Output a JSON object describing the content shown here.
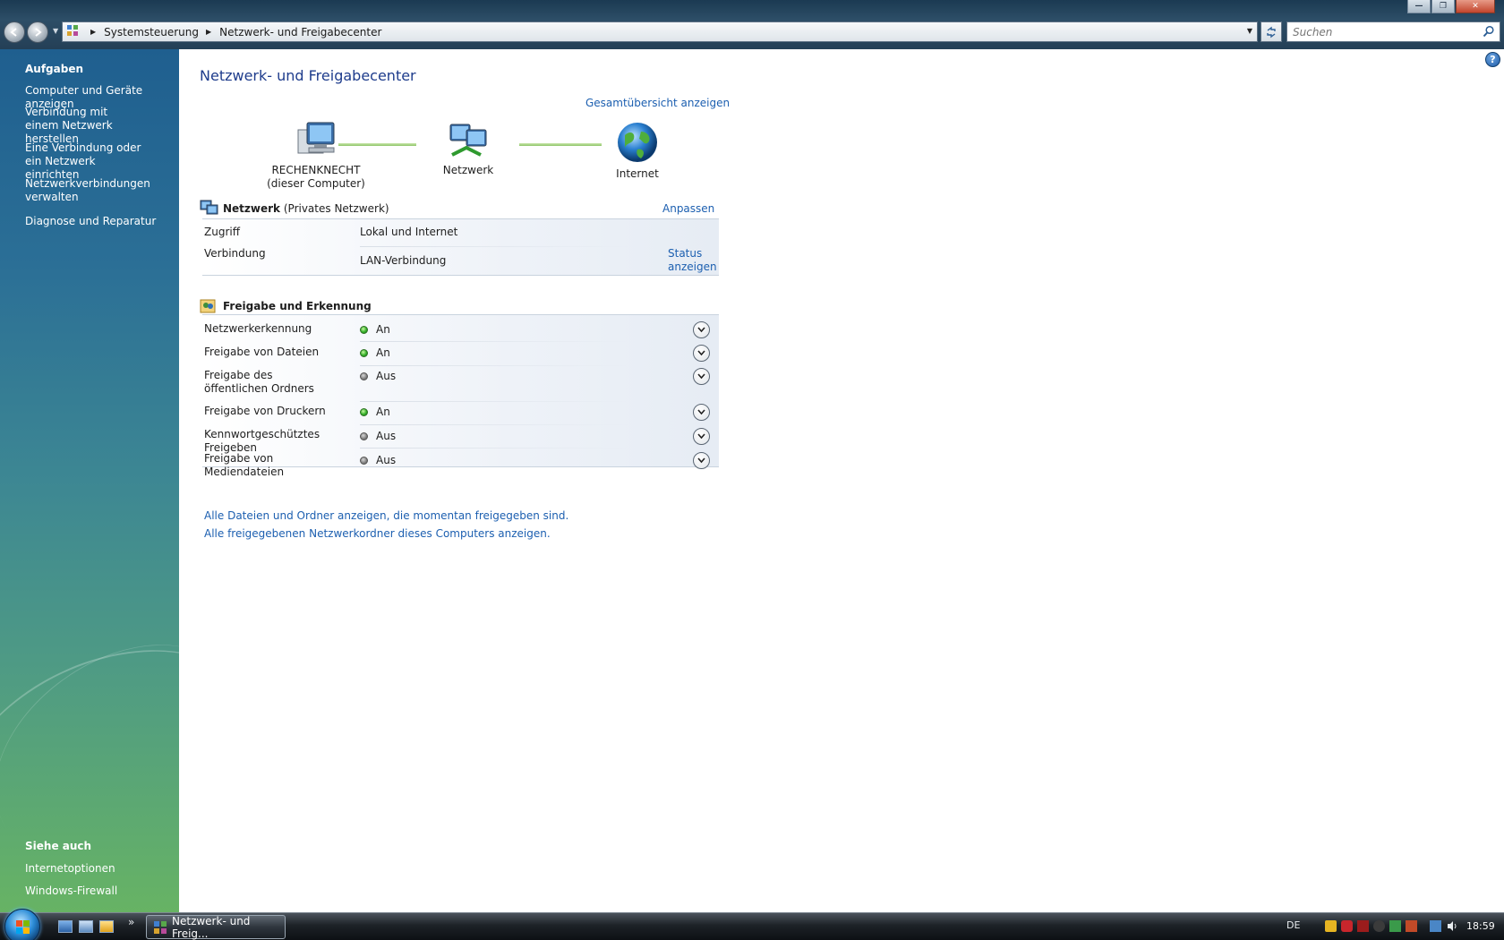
{
  "window": {
    "controls": {
      "minimize": "—",
      "maximize": "❐",
      "close": "✕"
    }
  },
  "navigation": {
    "back_icon": "back-arrow",
    "forward_icon": "forward-arrow"
  },
  "address": {
    "crumbs": [
      "Systemsteuerung",
      "Netzwerk- und Freigabecenter"
    ]
  },
  "search": {
    "placeholder": "Suchen"
  },
  "sidebar": {
    "tasks_heading": "Aufgaben",
    "tasks": [
      "Computer und Geräte anzeigen",
      "Verbindung mit einem Netzwerk herstellen",
      "Eine Verbindung oder ein Netzwerk einrichten",
      "Netzwerkverbindungen verwalten",
      "Diagnose und Reparatur"
    ],
    "see_also_heading": "Siehe auch",
    "see_also": [
      "Internetoptionen",
      "Windows-Firewall"
    ]
  },
  "main": {
    "title": "Netzwerk- und Freigabecenter",
    "overview_link": "Gesamtübersicht anzeigen",
    "map": {
      "computer_name": "RECHENKNECHT",
      "computer_sub": "(dieser Computer)",
      "network_label": "Netzwerk",
      "internet_label": "Internet"
    },
    "network": {
      "name": "Netzwerk",
      "type": "(Privates Netzwerk)",
      "customize_link": "Anpassen",
      "access_label": "Zugriff",
      "access_value": "Lokal und Internet",
      "connection_label": "Verbindung",
      "connection_value": "LAN-Verbindung",
      "status_link_1": "Status",
      "status_link_2": "anzeigen"
    },
    "sharing": {
      "heading": "Freigabe und Erkennung",
      "items": [
        {
          "label": "Netzwerkerkennung",
          "state": "An",
          "on": true
        },
        {
          "label": "Freigabe von Dateien",
          "state": "An",
          "on": true
        },
        {
          "label": "Freigabe des öffentlichen Ordners",
          "state": "Aus",
          "on": false
        },
        {
          "label": "Freigabe von Druckern",
          "state": "An",
          "on": true
        },
        {
          "label": "Kennwortgeschütztes Freigeben",
          "state": "Aus",
          "on": false
        },
        {
          "label": "Freigabe von Mediendateien",
          "state": "Aus",
          "on": false
        }
      ]
    },
    "links": [
      "Alle Dateien und Ordner anzeigen, die momentan freigegeben sind.",
      "Alle freigegebenen Netzwerkordner dieses Computers anzeigen."
    ]
  },
  "taskbar": {
    "active_window": "Netzwerk- und Freig...",
    "language": "DE",
    "clock": "18:59",
    "quicklaunch_more": "»"
  },
  "colors": {
    "link": "#1c5fb0",
    "title": "#1e3c8c",
    "status_on": "#34b02a",
    "status_off": "#7f7f7f"
  }
}
